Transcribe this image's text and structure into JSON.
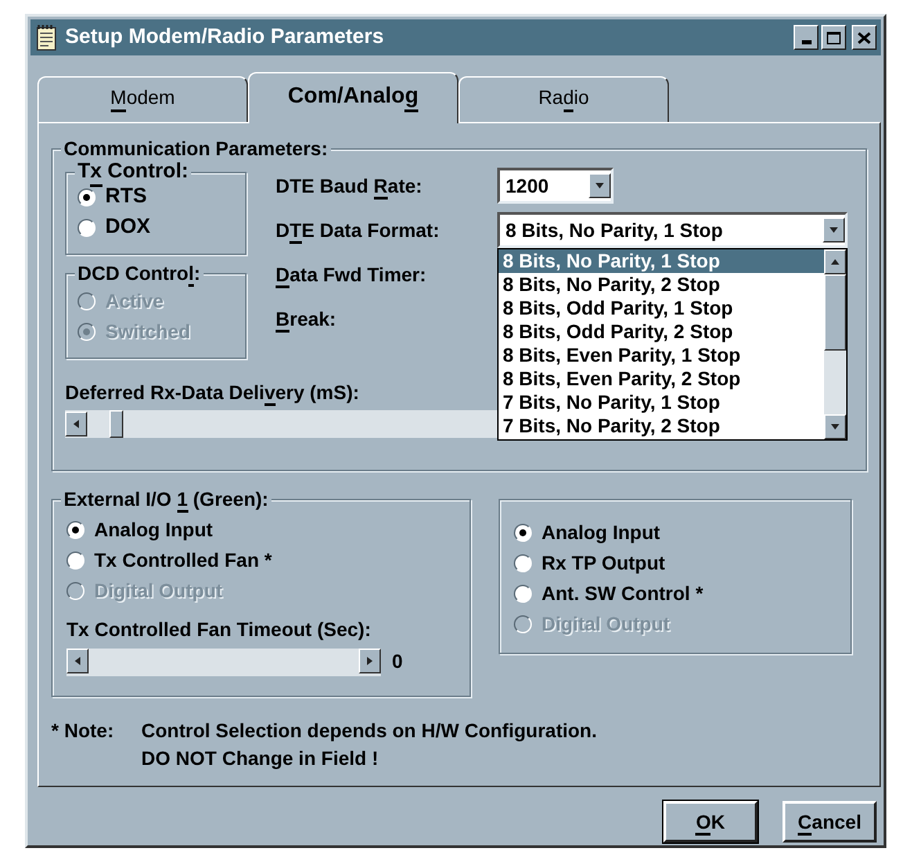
{
  "window": {
    "title": "Setup Modem/Radio Parameters"
  },
  "tabs": [
    {
      "label": [
        {
          "text": "M",
          "underlined": true
        },
        {
          "text": "odem",
          "underlined": false
        }
      ],
      "selected": false
    },
    {
      "label": [
        {
          "text": "Com/Analo",
          "underlined": false
        },
        {
          "text": "g",
          "underlined": true
        }
      ],
      "selected": true
    },
    {
      "label": [
        {
          "text": "Ra",
          "underlined": false
        },
        {
          "text": "d",
          "underlined": true
        },
        {
          "text": "io",
          "underlined": false
        }
      ],
      "selected": false
    }
  ],
  "communication": {
    "title": "Communication Parameters:",
    "tx_control": {
      "label": [
        {
          "text": "T",
          "underlined": false
        },
        {
          "text": "x",
          "underlined": true
        },
        {
          "text": " Control:",
          "underlined": false
        }
      ],
      "options": [
        {
          "label": "RTS",
          "selected": true,
          "disabled": false
        },
        {
          "label": "DOX",
          "selected": false,
          "disabled": false
        }
      ]
    },
    "dcd_control": {
      "label": [
        {
          "text": "DCD Contro",
          "underlined": false
        },
        {
          "text": "l",
          "underlined": true
        },
        {
          "text": ":",
          "underlined": false
        }
      ],
      "options": [
        {
          "label": "Active",
          "selected": false,
          "disabled": true
        },
        {
          "label": "Switched",
          "selected": true,
          "disabled": true
        }
      ]
    },
    "fields": [
      {
        "kind": "combo",
        "label": [
          {
            "text": "DTE Baud ",
            "underlined": false
          },
          {
            "text": "R",
            "underlined": true
          },
          {
            "text": "ate:",
            "underlined": false
          }
        ],
        "value": "1200",
        "open": false
      },
      {
        "kind": "combo",
        "label": [
          {
            "text": "D",
            "underlined": false
          },
          {
            "text": "T",
            "underlined": true
          },
          {
            "text": "E Data Format:",
            "underlined": false
          }
        ],
        "value": "8 Bits, No Parity, 1 Stop",
        "open": true,
        "options": [
          {
            "label": "8 Bits, No Parity, 1 Stop",
            "selected": true
          },
          {
            "label": "8 Bits, No Parity, 2 Stop",
            "selected": false
          },
          {
            "label": "8 Bits, Odd Parity, 1 Stop",
            "selected": false
          },
          {
            "label": "8 Bits, Odd Parity, 2 Stop",
            "selected": false
          },
          {
            "label": "8 Bits, Even Parity, 1 Stop",
            "selected": false
          },
          {
            "label": "8 Bits, Even Parity, 2 Stop",
            "selected": false
          },
          {
            "label": "7 Bits, No Parity, 1 Stop",
            "selected": false
          },
          {
            "label": "7 Bits, No Parity, 2 Stop",
            "selected": false
          }
        ]
      },
      {
        "kind": "covered",
        "label": [
          {
            "text": "D",
            "underlined": true
          },
          {
            "text": "ata Fwd Timer:",
            "underlined": false
          }
        ]
      },
      {
        "kind": "covered",
        "label": [
          {
            "text": "B",
            "underlined": true
          },
          {
            "text": "reak:",
            "underlined": false
          }
        ]
      }
    ],
    "deferred": {
      "label": [
        {
          "text": "Deferred Rx-Data Deli",
          "underlined": false
        },
        {
          "text": "v",
          "underlined": true
        },
        {
          "text": "ery (mS):",
          "underlined": false
        }
      ],
      "level": 0.03
    }
  },
  "external_1": {
    "title": [
      {
        "text": "External I/O ",
        "underlined": false
      },
      {
        "text": "1",
        "underlined": true
      },
      {
        "text": " (Green):",
        "underlined": false
      }
    ],
    "options": [
      {
        "label": "Analog Input",
        "selected": true,
        "disabled": false
      },
      {
        "label": "Tx Controlled Fan *",
        "selected": false,
        "disabled": false
      },
      {
        "label": "Digital Output",
        "selected": false,
        "disabled": true
      }
    ],
    "fan_timeout": {
      "label": "Tx Controlled Fan Timeout (Sec):",
      "reading": "0"
    }
  },
  "external_2": {
    "options": [
      {
        "label": "Analog Input",
        "selected": true,
        "disabled": false
      },
      {
        "label": "Rx TP Output",
        "selected": false,
        "disabled": false
      },
      {
        "label": "Ant. SW Control *",
        "selected": false,
        "disabled": false
      },
      {
        "label": "Digital Output",
        "selected": false,
        "disabled": true
      }
    ]
  },
  "note": {
    "marker": "* Note:",
    "lines": [
      "Control Selection depends on H/W Configuration.",
      "DO NOT Change in Field !"
    ]
  },
  "buttons": [
    {
      "label": [
        {
          "text": "O",
          "underlined": true
        },
        {
          "text": "K",
          "underlined": false
        }
      ],
      "default": true
    },
    {
      "label": [
        {
          "text": "C",
          "underlined": true
        },
        {
          "text": "ancel",
          "underlined": false
        }
      ],
      "default": false
    }
  ]
}
